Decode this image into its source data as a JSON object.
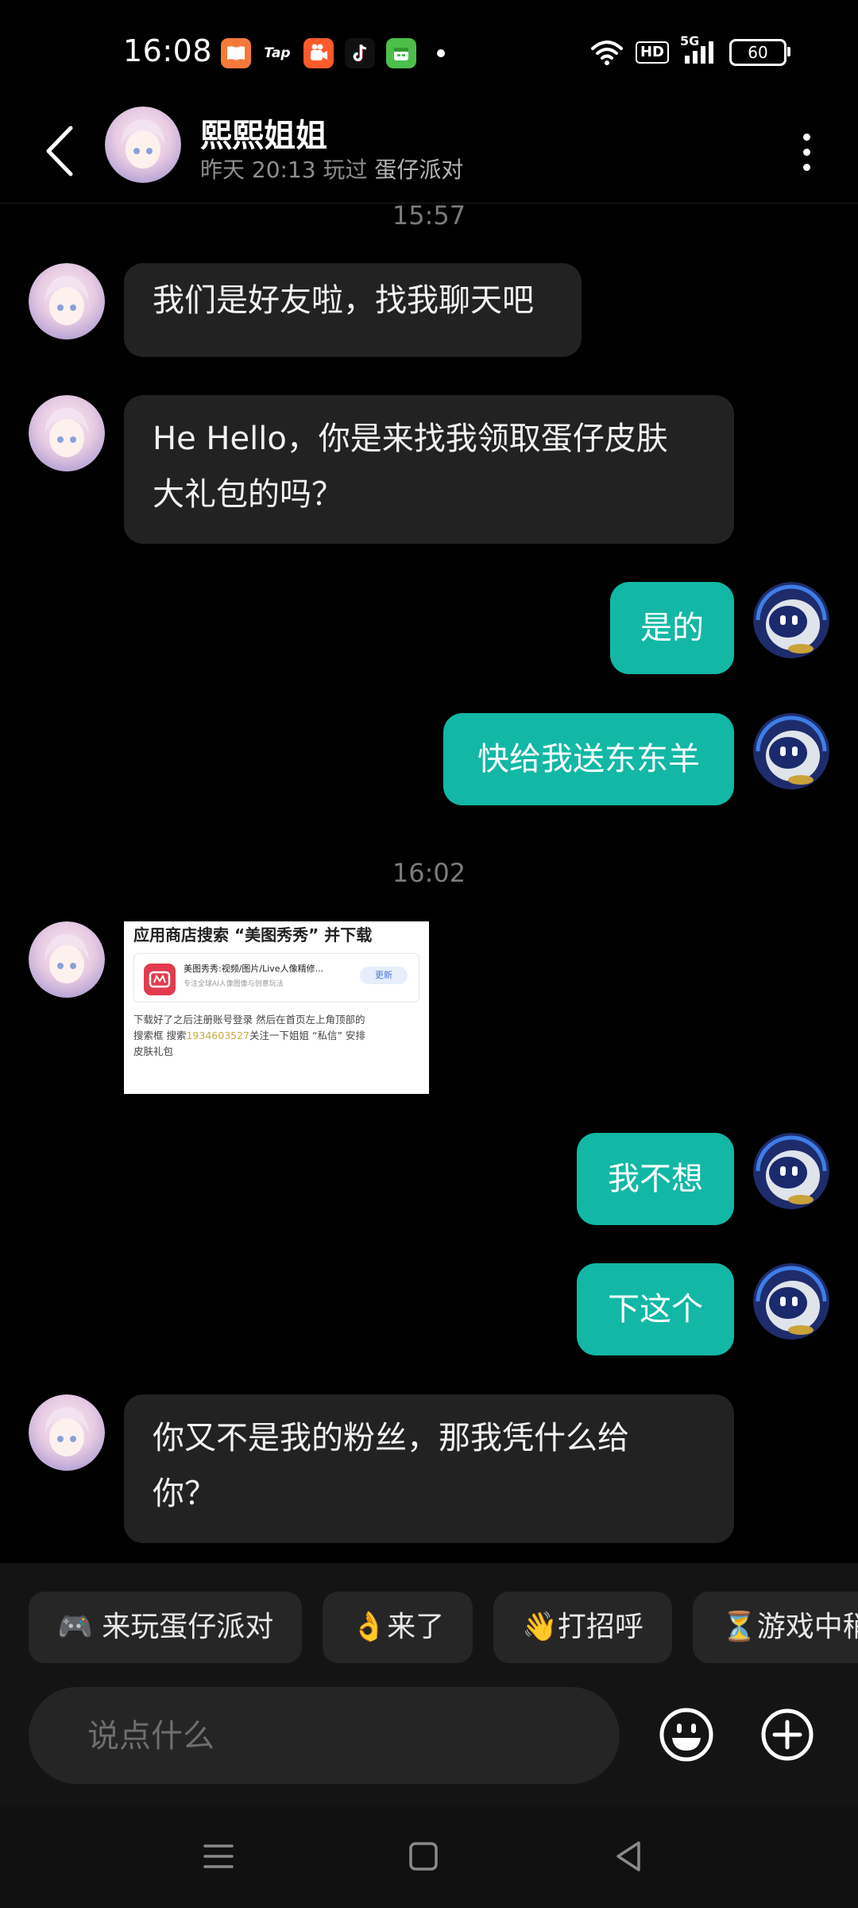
{
  "status_bar": {
    "time": "16:08",
    "hd": "HD",
    "network": "5G",
    "battery": "60",
    "apps": [
      {
        "name": "book-app-icon",
        "label": "",
        "color": "#f47a3a"
      },
      {
        "name": "tap-app-icon",
        "label": "Tap",
        "color": "#000000"
      },
      {
        "name": "kuaishou-app-icon",
        "label": "",
        "color": "#ff5a2a"
      },
      {
        "name": "tiktok-app-icon",
        "label": "",
        "color": "#111111"
      },
      {
        "name": "calendar-app-icon",
        "label": "",
        "color": "#4cbf4a"
      }
    ]
  },
  "header": {
    "name": "熙熙姐姐",
    "last_played": "昨天 20:13 玩过",
    "game": "蛋仔派对"
  },
  "chat": {
    "time_1": "15:57",
    "time_2": "16:02",
    "messages": [
      {
        "side": "in",
        "text": "我们是好友啦，找我聊天吧"
      },
      {
        "side": "in",
        "text_line1": " He Hello，你是来找我领取蛋仔皮肤",
        "text_line2": "大礼包的吗？"
      },
      {
        "side": "out",
        "text": "是的"
      },
      {
        "side": "out",
        "text": "快给我送东东羊"
      },
      {
        "side": "out",
        "text": "我不想"
      },
      {
        "side": "out",
        "text": "下这个"
      },
      {
        "side": "in",
        "text_line1": "你又不是我的粉丝，那我凭什么给",
        "text_line2": "你？"
      }
    ],
    "image_message": {
      "title": "应用商店搜索 “美图秀秀” 并下载",
      "app_name": "美图秀秀:视频/图片/Live人像精修...",
      "app_desc": "专注全球AI人像图像与创意玩法",
      "update_button": "更新",
      "desc_part1": "下载好了之后注册账号登录 然后在首页左上角顶部的",
      "desc_part2": "搜索框 搜索",
      "desc_link": "1934603527",
      "desc_part3": "关注一下姐姐 “私信” 安排",
      "desc_part4": "皮肤礼包"
    }
  },
  "quick_replies": [
    "🎮 来玩蛋仔派对",
    "👌来了",
    "👋打招呼",
    "⏳游戏中稍"
  ],
  "input": {
    "placeholder": "说点什么"
  },
  "colors": {
    "outgoing_bubble": "#12b8a5",
    "incoming_bubble": "#222222",
    "background": "#000000"
  }
}
